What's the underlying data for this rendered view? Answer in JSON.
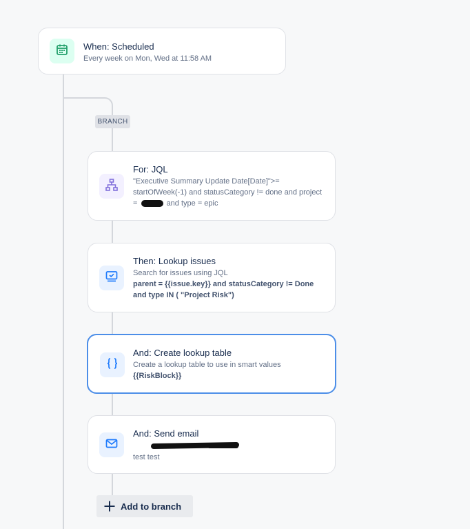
{
  "trigger": {
    "title": "When: Scheduled",
    "subtitle": "Every week on Mon, Wed at 11:58 AM",
    "icon": "calendar-icon",
    "color": "#22a06b"
  },
  "branch": {
    "tag": "BRANCH",
    "add_label": "Add to branch"
  },
  "steps": [
    {
      "title": "For: JQL",
      "line1": "\"Executive Summary Update Date[Date]\">=",
      "line2": "startOfWeek(-1) and statusCategory != done and project",
      "line3_prefix": "=",
      "line3_suffix": "and type = epic",
      "icon": "branch-hierarchy-icon",
      "color": "#8270db"
    },
    {
      "title": "Then: Lookup issues",
      "desc": "Search for issues using JQL",
      "bold_line1": "parent = {{issue.key}} and statusCategory != Done",
      "bold_line2": "and type IN ( \"Project Risk\")",
      "icon": "monitor-check-icon",
      "color": "#1d7afc"
    },
    {
      "title": "And: Create lookup table",
      "desc": "Create a lookup table to use in smart values",
      "bold_line": "{{RiskBlock}}",
      "icon": "curly-braces-icon",
      "color": "#1d7afc"
    },
    {
      "title": "And: Send email",
      "desc": "test test",
      "icon": "envelope-icon",
      "color": "#1d7afc"
    }
  ]
}
